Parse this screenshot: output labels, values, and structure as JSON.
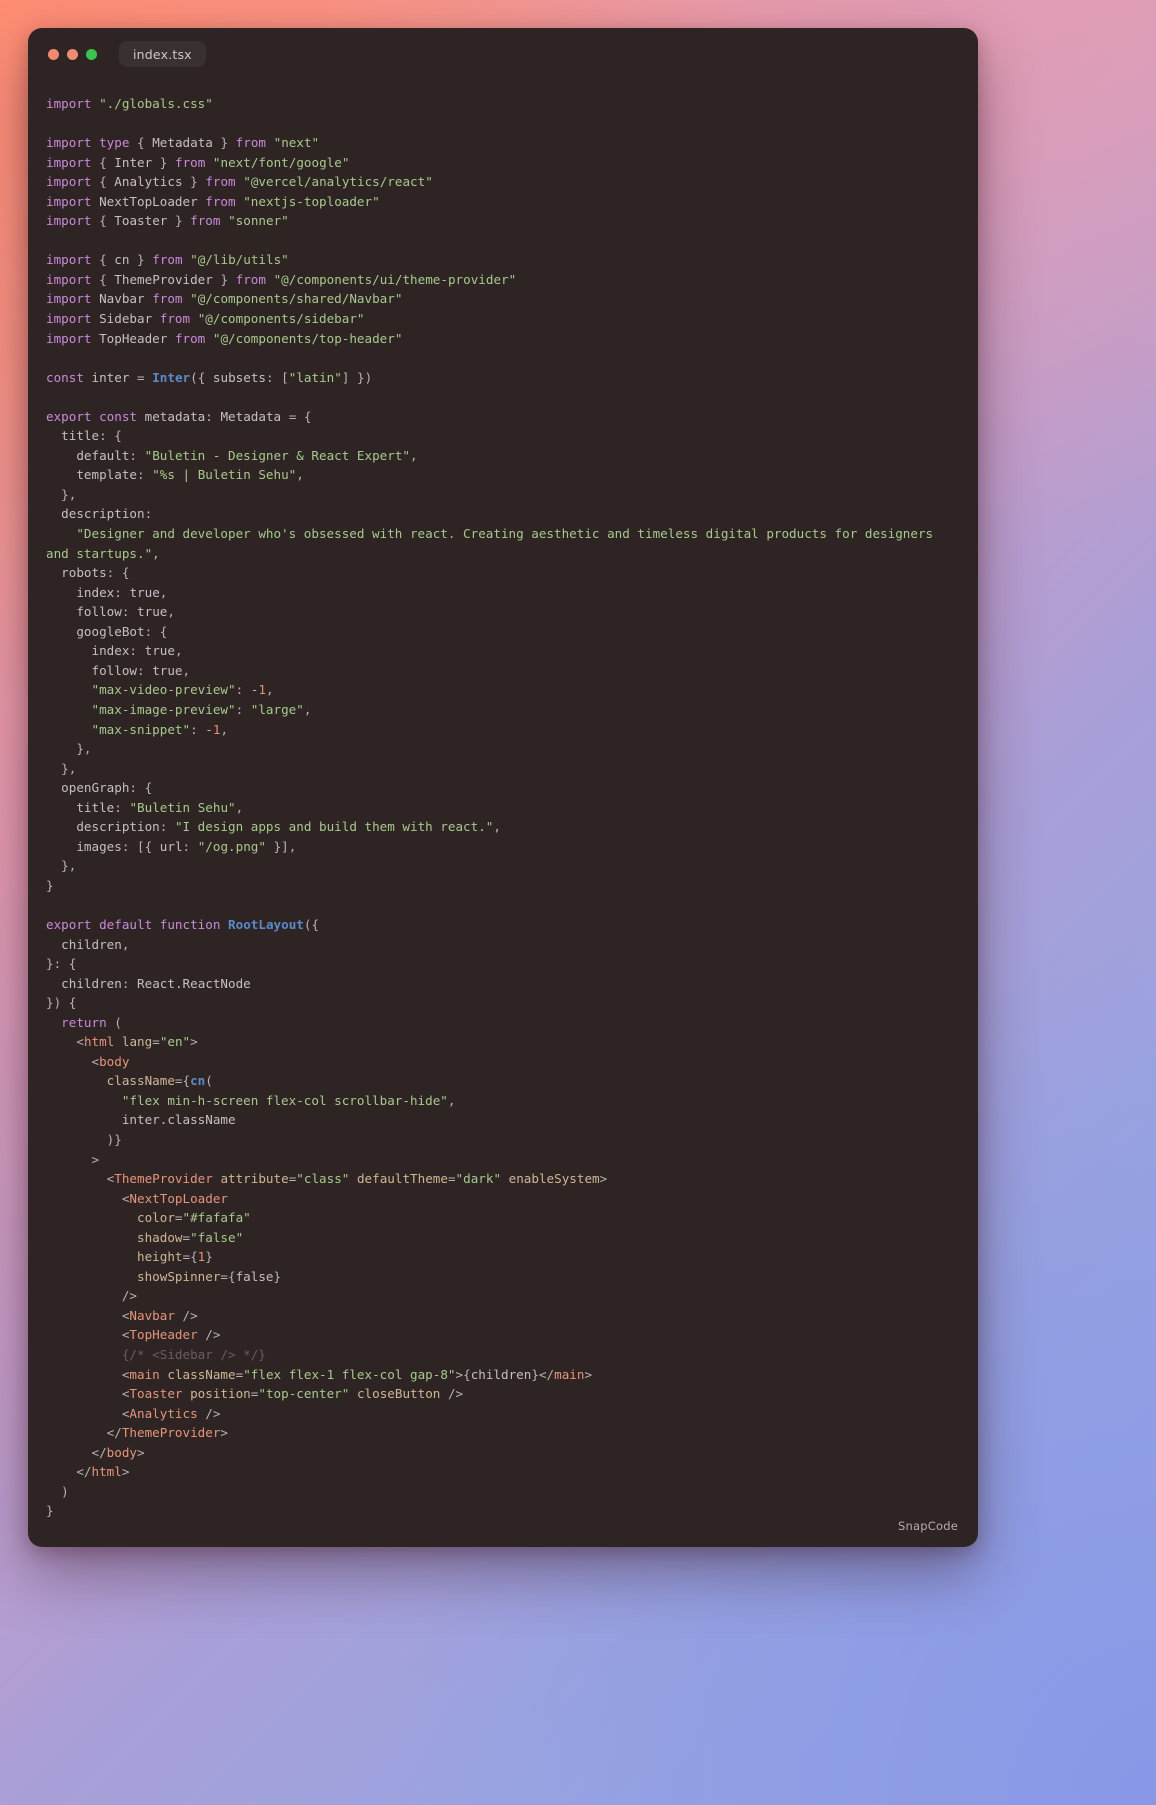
{
  "window": {
    "tab_label": "index.tsx",
    "watermark": "SnapCode",
    "traffic_lights": [
      "close-dot",
      "minimize-dot",
      "maximize-dot"
    ],
    "colors": {
      "window_bg": "#2e2424",
      "keyword": "#c98ad8",
      "string": "#a7c98d",
      "identifier": "#c5bfc0",
      "function": "#5b8ac9",
      "number": "#e8917a",
      "jsx_tag": "#e6947c",
      "jsx_attribute": "#cdb795",
      "comment": "#6b5c5c",
      "dot_red": "#f08a72",
      "dot_yellow": "#ef8a74",
      "dot_green": "#39c44d"
    }
  },
  "code": {
    "language": "tsx",
    "lines": [
      "<span class=\"k\">import</span> <span class=\"s\">\"./globals.css\"</span>",
      "",
      "<span class=\"k\">import</span> <span class=\"k\">type</span> <span class=\"p\">{</span> <span class=\"id\">Metadata</span> <span class=\"p\">}</span> <span class=\"k\">from</span> <span class=\"s\">\"next\"</span>",
      "<span class=\"k\">import</span> <span class=\"p\">{</span> <span class=\"id\">Inter</span> <span class=\"p\">}</span> <span class=\"k\">from</span> <span class=\"s\">\"next/font/google\"</span>",
      "<span class=\"k\">import</span> <span class=\"p\">{</span> <span class=\"id\">Analytics</span> <span class=\"p\">}</span> <span class=\"k\">from</span> <span class=\"s\">\"@vercel/analytics/react\"</span>",
      "<span class=\"k\">import</span> <span class=\"id\">NextTopLoader</span> <span class=\"k\">from</span> <span class=\"s\">\"nextjs-toploader\"</span>",
      "<span class=\"k\">import</span> <span class=\"p\">{</span> <span class=\"id\">Toaster</span> <span class=\"p\">}</span> <span class=\"k\">from</span> <span class=\"s\">\"sonner\"</span>",
      "",
      "<span class=\"k\">import</span> <span class=\"p\">{</span> <span class=\"id\">cn</span> <span class=\"p\">}</span> <span class=\"k\">from</span> <span class=\"s\">\"@/lib/utils\"</span>",
      "<span class=\"k\">import</span> <span class=\"p\">{</span> <span class=\"id\">ThemeProvider</span> <span class=\"p\">}</span> <span class=\"k\">from</span> <span class=\"s\">\"@/components/ui/theme-provider\"</span>",
      "<span class=\"k\">import</span> <span class=\"id\">Navbar</span> <span class=\"k\">from</span> <span class=\"s\">\"@/components/shared/Navbar\"</span>",
      "<span class=\"k\">import</span> <span class=\"id\">Sidebar</span> <span class=\"k\">from</span> <span class=\"s\">\"@/components/sidebar\"</span>",
      "<span class=\"k\">import</span> <span class=\"id\">TopHeader</span> <span class=\"k\">from</span> <span class=\"s\">\"@/components/top-header\"</span>",
      "",
      "<span class=\"k\">const</span> <span class=\"id\">inter</span> <span class=\"p\">=</span> <span class=\"fn\">Inter</span><span class=\"p\">({</span> <span class=\"id\">subsets</span><span class=\"p\">:</span> <span class=\"p\">[</span><span class=\"s\">\"latin\"</span><span class=\"p\">] })</span>",
      "",
      "<span class=\"k\">export</span> <span class=\"k\">const</span> <span class=\"id\">metadata</span><span class=\"p\">:</span> <span class=\"id\">Metadata</span> <span class=\"p\">= {</span>",
      "  <span class=\"id\">title</span><span class=\"p\">: {</span>",
      "    <span class=\"id\">default</span><span class=\"p\">:</span> <span class=\"s\">\"Buletin - Designer &amp; React Expert\"</span><span class=\"p\">,</span>",
      "    <span class=\"id\">template</span><span class=\"p\">:</span> <span class=\"s\">\"%s | Buletin Sehu\"</span><span class=\"p\">,</span>",
      "  <span class=\"p\">},</span>",
      "  <span class=\"id\">description</span><span class=\"p\">:</span>",
      "    <span class=\"s\">\"Designer and developer who's obsessed with react. Creating aesthetic and timeless digital products for designers and startups.\"</span><span class=\"p\">,</span>",
      "  <span class=\"id\">robots</span><span class=\"p\">: {</span>",
      "    <span class=\"id\">index</span><span class=\"p\">:</span> <span class=\"bo\">true</span><span class=\"p\">,</span>",
      "    <span class=\"id\">follow</span><span class=\"p\">:</span> <span class=\"bo\">true</span><span class=\"p\">,</span>",
      "    <span class=\"id\">googleBot</span><span class=\"p\">: {</span>",
      "      <span class=\"id\">index</span><span class=\"p\">:</span> <span class=\"bo\">true</span><span class=\"p\">,</span>",
      "      <span class=\"id\">follow</span><span class=\"p\">:</span> <span class=\"bo\">true</span><span class=\"p\">,</span>",
      "      <span class=\"s\">\"max-video-preview\"</span><span class=\"p\">:</span> <span class=\"p\">-</span><span class=\"num\">1</span><span class=\"p\">,</span>",
      "      <span class=\"s\">\"max-image-preview\"</span><span class=\"p\">:</span> <span class=\"s\">\"large\"</span><span class=\"p\">,</span>",
      "      <span class=\"s\">\"max-snippet\"</span><span class=\"p\">:</span> <span class=\"p\">-</span><span class=\"num\">1</span><span class=\"p\">,</span>",
      "    <span class=\"p\">},</span>",
      "  <span class=\"p\">},</span>",
      "  <span class=\"id\">openGraph</span><span class=\"p\">: {</span>",
      "    <span class=\"id\">title</span><span class=\"p\">:</span> <span class=\"s\">\"Buletin Sehu\"</span><span class=\"p\">,</span>",
      "    <span class=\"id\">description</span><span class=\"p\">:</span> <span class=\"s\">\"I design apps and build them with react.\"</span><span class=\"p\">,</span>",
      "    <span class=\"id\">images</span><span class=\"p\">: [{</span> <span class=\"id\">url</span><span class=\"p\">:</span> <span class=\"s\">\"/og.png\"</span> <span class=\"p\">}],</span>",
      "  <span class=\"p\">},</span>",
      "<span class=\"p\">}</span>",
      "",
      "<span class=\"k\">export</span> <span class=\"k\">default</span> <span class=\"k\">function</span> <span class=\"fn\">RootLayout</span><span class=\"p\">({</span>",
      "  <span class=\"id\">children</span><span class=\"p\">,</span>",
      "<span class=\"p\">}: {</span>",
      "  <span class=\"id\">children</span><span class=\"p\">:</span> <span class=\"id\">React.ReactNode</span>",
      "<span class=\"p\">}) {</span>",
      "  <span class=\"k\">return</span> <span class=\"p\">(</span>",
      "    <span class=\"p\">&lt;</span><span class=\"tag\">html</span> <span class=\"at\">lang</span><span class=\"p\">=</span><span class=\"s\">\"en\"</span><span class=\"p\">&gt;</span>",
      "      <span class=\"p\">&lt;</span><span class=\"tag\">body</span>",
      "        <span class=\"at\">className</span><span class=\"p\">={</span><span class=\"fn\">cn</span><span class=\"p\">(</span>",
      "          <span class=\"s\">\"flex min-h-screen flex-col scrollbar-hide\"</span><span class=\"p\">,</span>",
      "          <span class=\"id\">inter.className</span>",
      "        <span class=\"p\">)}</span>",
      "      <span class=\"p\">&gt;</span>",
      "        <span class=\"p\">&lt;</span><span class=\"tag\">ThemeProvider</span> <span class=\"at\">attribute</span><span class=\"p\">=</span><span class=\"s\">\"class\"</span> <span class=\"at\">defaultTheme</span><span class=\"p\">=</span><span class=\"s\">\"dark\"</span> <span class=\"at\">enableSystem</span><span class=\"p\">&gt;</span>",
      "          <span class=\"p\">&lt;</span><span class=\"tag\">NextTopLoader</span>",
      "            <span class=\"at\">color</span><span class=\"p\">=</span><span class=\"s\">\"#fafafa\"</span>",
      "            <span class=\"at\">shadow</span><span class=\"p\">=</span><span class=\"s\">\"false\"</span>",
      "            <span class=\"at\">height</span><span class=\"p\">={</span><span class=\"num\">1</span><span class=\"p\">}</span>",
      "            <span class=\"at\">showSpinner</span><span class=\"p\">={</span><span class=\"bo\">false</span><span class=\"p\">}</span>",
      "          <span class=\"p\">/&gt;</span>",
      "          <span class=\"p\">&lt;</span><span class=\"tag\">Navbar</span> <span class=\"p\">/&gt;</span>",
      "          <span class=\"p\">&lt;</span><span class=\"tag\">TopHeader</span> <span class=\"p\">/&gt;</span>",
      "          <span class=\"cm\">{/* &lt;Sidebar /&gt; */}</span>",
      "          <span class=\"p\">&lt;</span><span class=\"tag\">main</span> <span class=\"at\">className</span><span class=\"p\">=</span><span class=\"s\">\"flex flex-1 flex-col gap-8\"</span><span class=\"p\">&gt;{</span><span class=\"id\">children</span><span class=\"p\">}&lt;/</span><span class=\"tag\">main</span><span class=\"p\">&gt;</span>",
      "          <span class=\"p\">&lt;</span><span class=\"tag\">Toaster</span> <span class=\"at\">position</span><span class=\"p\">=</span><span class=\"s\">\"top-center\"</span> <span class=\"at\">closeButton</span> <span class=\"p\">/&gt;</span>",
      "          <span class=\"p\">&lt;</span><span class=\"tag\">Analytics</span> <span class=\"p\">/&gt;</span>",
      "        <span class=\"p\">&lt;/</span><span class=\"tag\">ThemeProvider</span><span class=\"p\">&gt;</span>",
      "      <span class=\"p\">&lt;/</span><span class=\"tag\">body</span><span class=\"p\">&gt;</span>",
      "    <span class=\"p\">&lt;/</span><span class=\"tag\">html</span><span class=\"p\">&gt;</span>",
      "  <span class=\"p\">)</span>",
      "<span class=\"p\">}</span>"
    ],
    "plain_text": "import \"./globals.css\"\n\nimport type { Metadata } from \"next\"\nimport { Inter } from \"next/font/google\"\nimport { Analytics } from \"@vercel/analytics/react\"\nimport NextTopLoader from \"nextjs-toploader\"\nimport { Toaster } from \"sonner\"\n\nimport { cn } from \"@/lib/utils\"\nimport { ThemeProvider } from \"@/components/ui/theme-provider\"\nimport Navbar from \"@/components/shared/Navbar\"\nimport Sidebar from \"@/components/sidebar\"\nimport TopHeader from \"@/components/top-header\"\n\nconst inter = Inter({ subsets: [\"latin\"] })\n\nexport const metadata: Metadata = {\n  title: {\n    default: \"Buletin - Designer & React Expert\",\n    template: \"%s | Buletin Sehu\",\n  },\n  description:\n    \"Designer and developer who's obsessed with react. Creating aesthetic and timeless digital products for designers and startups.\",\n  robots: {\n    index: true,\n    follow: true,\n    googleBot: {\n      index: true,\n      follow: true,\n      \"max-video-preview\": -1,\n      \"max-image-preview\": \"large\",\n      \"max-snippet\": -1,\n    },\n  },\n  openGraph: {\n    title: \"Buletin Sehu\",\n    description: \"I design apps and build them with react.\",\n    images: [{ url: \"/og.png\" }],\n  },\n}\n\nexport default function RootLayout({\n  children,\n}: {\n  children: React.ReactNode\n}) {\n  return (\n    <html lang=\"en\">\n      <body\n        className={cn(\n          \"flex min-h-screen flex-col scrollbar-hide\",\n          inter.className\n        )}\n      >\n        <ThemeProvider attribute=\"class\" defaultTheme=\"dark\" enableSystem>\n          <NextTopLoader\n            color=\"#fafafa\"\n            shadow=\"false\"\n            height={1}\n            showSpinner={false}\n          />\n          <Navbar />\n          <TopHeader />\n          {/* <Sidebar /> */}\n          <main className=\"flex flex-1 flex-col gap-8\">{children}</main>\n          <Toaster position=\"top-center\" closeButton />\n          <Analytics />\n        </ThemeProvider>\n      </body>\n    </html>\n  )\n}"
  }
}
